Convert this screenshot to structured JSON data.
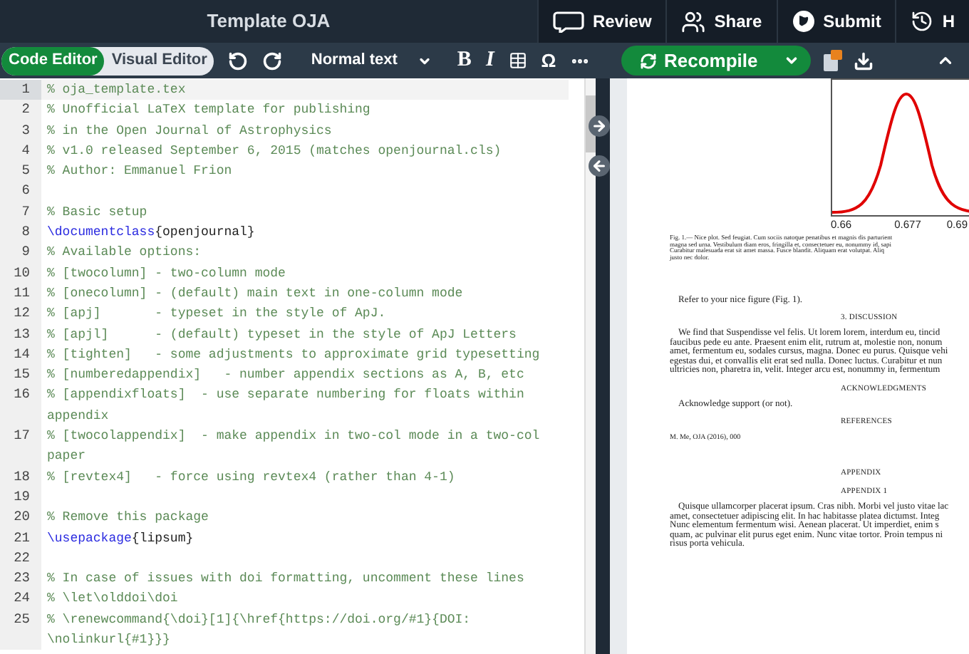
{
  "window": {
    "title": "Template OJA"
  },
  "header_buttons": [
    {
      "kind": "review",
      "label": "Review"
    },
    {
      "kind": "share",
      "label": "Share"
    },
    {
      "kind": "submit",
      "label": "Submit"
    },
    {
      "kind": "history",
      "label": "H"
    }
  ],
  "editor_modes": [
    {
      "label": "Code Editor",
      "selected": true
    },
    {
      "label": "Visual Editor",
      "selected": false
    }
  ],
  "toolbar": {
    "style_dropdown": "Normal text",
    "bold": "B",
    "italic": "I",
    "symbol": "Ω"
  },
  "compile": {
    "label": "Recompile"
  },
  "code_lines": [
    {
      "number": "1",
      "selected": true,
      "segments": [
        {
          "kind": "comment",
          "text": "% oja_template.tex"
        }
      ]
    },
    {
      "number": "2",
      "selected": false,
      "segments": [
        {
          "kind": "comment",
          "text": "% Unofficial LaTeX template for publishing"
        }
      ]
    },
    {
      "number": "3",
      "selected": false,
      "segments": [
        {
          "kind": "comment",
          "text": "% in the Open Journal of Astrophysics"
        }
      ]
    },
    {
      "number": "4",
      "selected": false,
      "segments": [
        {
          "kind": "comment",
          "text": "% v1.0 released September 6, 2015 (matches openjournal.cls)"
        }
      ]
    },
    {
      "number": "5",
      "selected": false,
      "segments": [
        {
          "kind": "comment",
          "text": "% Author: Emmanuel Frion"
        }
      ]
    },
    {
      "number": "6",
      "selected": false
    },
    {
      "number": "7",
      "selected": false,
      "segments": [
        {
          "kind": "comment",
          "text": "% Basic setup"
        }
      ]
    },
    {
      "number": "8",
      "selected": false,
      "segments": [
        {
          "kind": "command",
          "text": "\\documentclass"
        },
        {
          "kind": "text",
          "text": "{openjournal}"
        }
      ]
    },
    {
      "number": "9",
      "selected": false,
      "segments": [
        {
          "kind": "comment",
          "text": "% Available options:"
        }
      ]
    },
    {
      "number": "10",
      "selected": false,
      "segments": [
        {
          "kind": "comment",
          "text": "% [twocolumn] - two-column mode"
        }
      ]
    },
    {
      "number": "11",
      "selected": false,
      "segments": [
        {
          "kind": "comment",
          "text": "% [onecolumn] - (default) main text in one-column mode"
        }
      ]
    },
    {
      "number": "12",
      "selected": false,
      "segments": [
        {
          "kind": "comment",
          "text": "% [apj]       - typeset in the style of ApJ."
        }
      ]
    },
    {
      "number": "13",
      "selected": false,
      "segments": [
        {
          "kind": "comment",
          "text": "% [apjl]      - (default) typeset in the style of ApJ Letters"
        }
      ]
    },
    {
      "number": "14",
      "selected": false,
      "segments": [
        {
          "kind": "comment",
          "text": "% [tighten]   - some adjustments to approximate grid typesetting"
        }
      ]
    },
    {
      "number": "15",
      "selected": false,
      "segments": [
        {
          "kind": "comment",
          "text": "% [numberedappendix]   - number appendix sections as A, B, etc"
        }
      ]
    },
    {
      "number": "16",
      "selected": false,
      "segments": [
        {
          "kind": "comment",
          "text": "% [appendixfloats]  - use separate numbering for floats within appendix"
        }
      ]
    },
    {
      "number": "17",
      "selected": false,
      "segments": [
        {
          "kind": "comment",
          "text": "% [twocolappendix]  - make appendix in two-col mode in a two-col paper"
        }
      ]
    },
    {
      "number": "18",
      "selected": false,
      "segments": [
        {
          "kind": "comment",
          "text": "% [revtex4]   - force using revtex4 (rather than 4-1)"
        }
      ]
    },
    {
      "number": "19",
      "selected": false
    },
    {
      "number": "20",
      "selected": false,
      "segments": [
        {
          "kind": "comment",
          "text": "% Remove this package"
        }
      ]
    },
    {
      "number": "21",
      "selected": false,
      "segments": [
        {
          "kind": "command",
          "text": "\\usepackage"
        },
        {
          "kind": "text",
          "text": "{lipsum}"
        }
      ]
    },
    {
      "number": "22",
      "selected": false
    },
    {
      "number": "23",
      "selected": false,
      "segments": [
        {
          "kind": "comment",
          "text": "% In case of issues with doi formatting, uncomment these lines"
        }
      ]
    },
    {
      "number": "24",
      "selected": false,
      "segments": [
        {
          "kind": "comment",
          "text": "% \\let\\olddoi\\doi"
        }
      ]
    },
    {
      "number": "25",
      "selected": false,
      "segments": [
        {
          "kind": "comment",
          "text": "% \\renewcommand{\\doi}[1]{\\href{https://doi.org/#1}{DOI: \\nolinkurl{#1}}}"
        }
      ]
    }
  ],
  "pdf": {
    "figure_ticks": [
      "0.66",
      "0.677",
      "0.69"
    ],
    "caption": [
      "Fig. 1.— Nice plot. Sed feugiat. Cum sociis natoque penatibus et magnis dis parturient",
      "magna sed urna. Vestibulum diam eros, fringilla et, consectetuer eu, nonummy id, sapi",
      "Curabitur malesuada erat sit amet massa. Fusce blandit. Aliquam erat volutpat. Aliq",
      "justo nec dolor."
    ],
    "blocks": [
      {
        "kind": "text",
        "lines": [
          "Refer to your nice figure (Fig. 1)."
        ]
      },
      {
        "kind": "heading",
        "lines": [
          "3. DISCUSSION"
        ]
      },
      {
        "kind": "paragraph",
        "lines": [
          "We find that Suspendisse vel felis. Ut lorem lorem, interdum eu, tincid",
          "faucibus pede eu ante. Praesent enim elit, rutrum at, molestie non, nonum",
          "amet, fermentum eu, sodales cursus, magna. Donec eu purus. Quisque vehi",
          "egestas dui, et convallis elit erat sed nulla. Donec luctus. Curabitur et nun",
          "ultricies non, pharetra in, velit. Integer arcu est, nonummy in, fermentum"
        ]
      },
      {
        "kind": "heading",
        "lines": [
          "ACKNOWLEDGMENTS"
        ]
      },
      {
        "kind": "paragraph",
        "lines": [
          "Acknowledge support (or not)."
        ]
      },
      {
        "kind": "heading",
        "lines": [
          "REFERENCES"
        ]
      },
      {
        "kind": "reference",
        "lines": [
          "M. Me, OJA (2016), 000"
        ]
      },
      {
        "kind": "spacer"
      },
      {
        "kind": "heading",
        "lines": [
          "APPENDIX"
        ]
      },
      {
        "kind": "heading",
        "lines": [
          "APPENDIX 1"
        ]
      },
      {
        "kind": "paragraph",
        "lines": [
          "Quisque ullamcorper placerat ipsum. Cras nibh. Morbi vel justo vitae lac",
          "amet, consectetuer adipiscing elit. In hac habitasse platea dictumst. Integ",
          "Nunc elementum fermentum wisi. Aenean placerat. Ut imperdiet, enim s",
          "quam, ac pulvinar elit purus eget enim. Nunc vitae tortor. Proin tempus ni",
          "risus porta vehicula."
        ]
      }
    ]
  }
}
